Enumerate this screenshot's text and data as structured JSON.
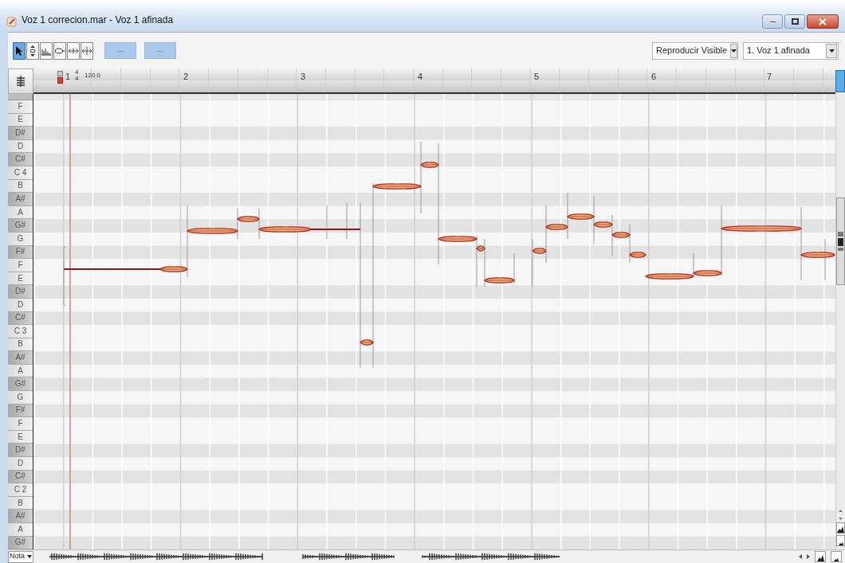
{
  "window": {
    "title": "Voz 1 correcion.mar - Voz 1 afinada"
  },
  "toolbar": {
    "tools": [
      {
        "kind": "pointer",
        "selected": true
      },
      {
        "kind": "pitch",
        "selected": false
      },
      {
        "kind": "amplitude",
        "selected": false
      },
      {
        "kind": "formant",
        "selected": false
      },
      {
        "kind": "time",
        "selected": false
      },
      {
        "kind": "split",
        "selected": false
      }
    ],
    "buttons": [
      "—",
      "—"
    ],
    "playback_mode": {
      "value": "Reproducir Visible"
    },
    "track": {
      "value": "1. Voz 1 afinada"
    }
  },
  "ruler": {
    "bars": [
      "1",
      "2",
      "3",
      "4",
      "5",
      "6",
      "7"
    ],
    "time_signature": {
      "numerator": "4",
      "denominator": "4"
    },
    "tempo": "120.0"
  },
  "keys": [
    {
      "label": "F",
      "kind": "natural"
    },
    {
      "label": "E",
      "kind": "natural"
    },
    {
      "label": "D#",
      "kind": "sharp"
    },
    {
      "label": "D",
      "kind": "natural"
    },
    {
      "label": "C#",
      "kind": "sharp"
    },
    {
      "label": "C 4",
      "kind": "natural"
    },
    {
      "label": "B",
      "kind": "natural"
    },
    {
      "label": "A#",
      "kind": "sharp"
    },
    {
      "label": "A",
      "kind": "natural"
    },
    {
      "label": "G#",
      "kind": "sharp"
    },
    {
      "label": "G",
      "kind": "natural"
    },
    {
      "label": "F#",
      "kind": "sharp"
    },
    {
      "label": "F",
      "kind": "natural"
    },
    {
      "label": "E",
      "kind": "natural"
    },
    {
      "label": "D#",
      "kind": "sharp"
    },
    {
      "label": "D",
      "kind": "natural"
    },
    {
      "label": "C#",
      "kind": "sharp"
    },
    {
      "label": "C 3",
      "kind": "natural"
    },
    {
      "label": "B",
      "kind": "natural"
    },
    {
      "label": "A#",
      "kind": "sharp"
    },
    {
      "label": "A",
      "kind": "natural"
    },
    {
      "label": "G#",
      "kind": "sharp"
    },
    {
      "label": "G",
      "kind": "natural"
    },
    {
      "label": "F#",
      "kind": "sharp"
    },
    {
      "label": "F",
      "kind": "natural"
    },
    {
      "label": "E",
      "kind": "natural"
    },
    {
      "label": "D#",
      "kind": "sharp"
    },
    {
      "label": "D",
      "kind": "natural"
    },
    {
      "label": "C#",
      "kind": "sharp"
    },
    {
      "label": "C 2",
      "kind": "natural"
    },
    {
      "label": "B",
      "kind": "natural"
    },
    {
      "label": "A#",
      "kind": "sharp"
    },
    {
      "label": "A",
      "kind": "natural"
    },
    {
      "label": "G#",
      "kind": "sharp"
    }
  ],
  "bottom_bar": {
    "mode": "Nota"
  }
}
